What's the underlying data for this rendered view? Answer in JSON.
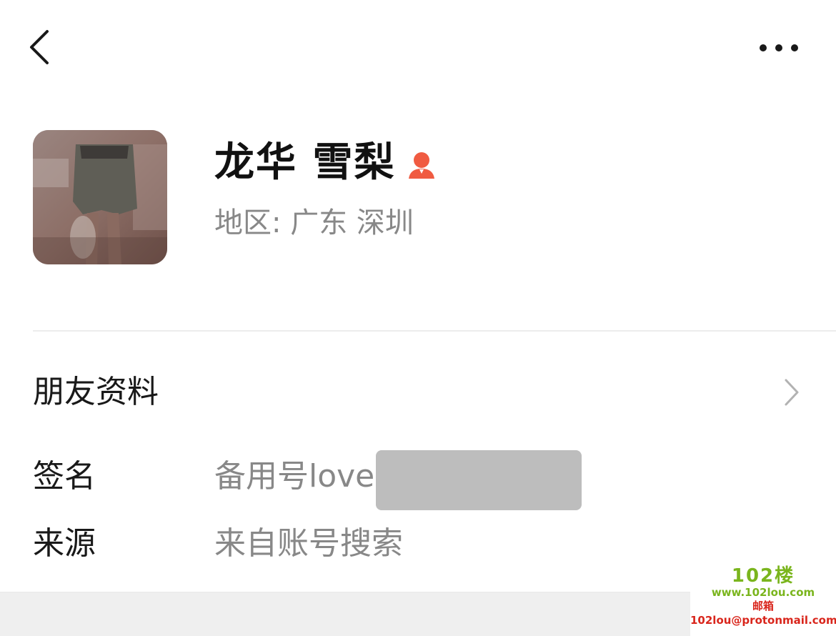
{
  "header": {
    "back_icon": "chevron-left-icon",
    "more_icon": "more-dots-icon"
  },
  "profile": {
    "name": "龙华 雪梨",
    "gender_icon": "female-user-icon",
    "gender_color": "#f05b41",
    "region": "地区:  广东  深圳"
  },
  "friend_info": {
    "label": "朋友资料",
    "chevron_icon": "chevron-right-icon"
  },
  "details": {
    "signature_label": "签名",
    "signature_value": "备用号love",
    "source_label": "来源",
    "source_value": "来自账号搜索"
  },
  "watermark": {
    "logo": "102楼",
    "url": "www.102lou.com",
    "mail_label": "邮箱",
    "mail": "102lou@protonmail.com",
    "logo_color": "#7ab51d",
    "mail_color": "#d9261c"
  }
}
